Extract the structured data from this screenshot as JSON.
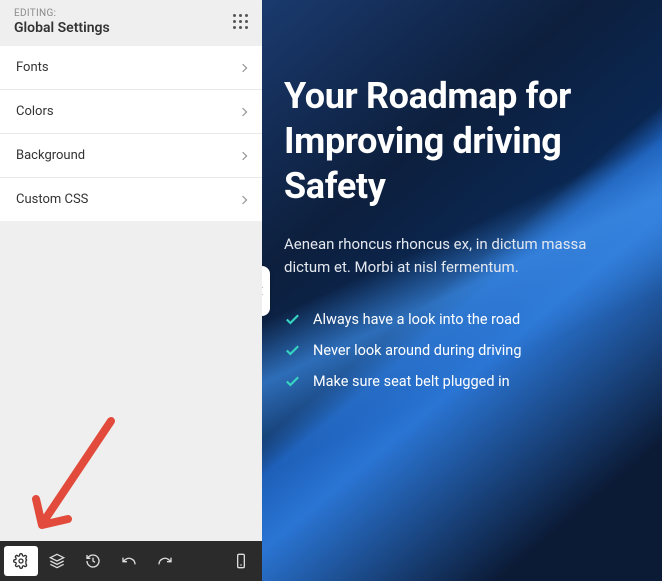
{
  "sidebar": {
    "editing_label": "EDITING:",
    "panel_title": "Global Settings",
    "menu": [
      {
        "label": "Fonts"
      },
      {
        "label": "Colors"
      },
      {
        "label": "Background"
      },
      {
        "label": "Custom CSS"
      }
    ]
  },
  "preview": {
    "hero_title": "Your Roadmap for Improving driving Safety",
    "hero_desc": "Aenean rhoncus rhoncus ex, in dictum massa dictum et. Morbi at nisl fermentum.",
    "checklist": [
      "Always have a look into the road",
      "Never look around during driving",
      "Make sure seat belt plugged in"
    ]
  }
}
